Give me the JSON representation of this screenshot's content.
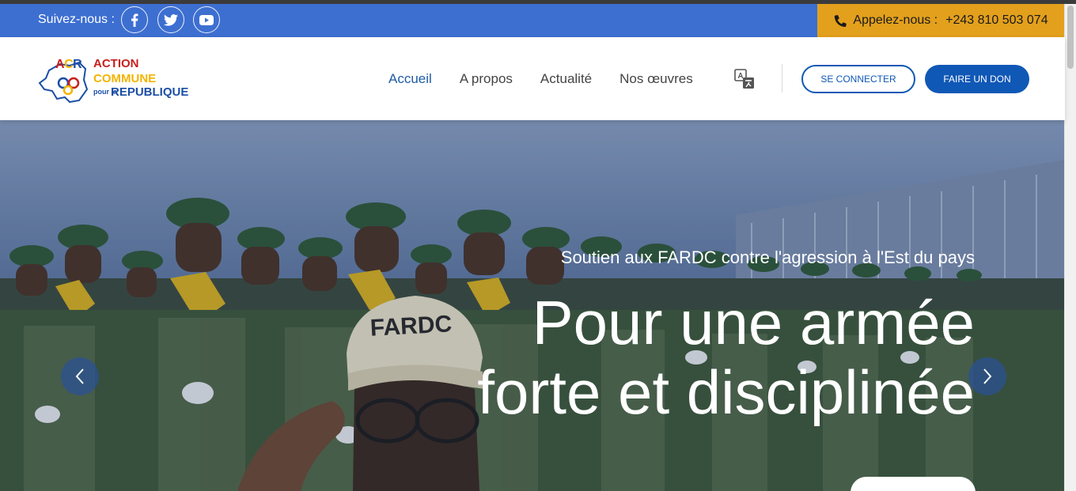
{
  "topbar": {
    "follow_label": "Suivez-nous :",
    "socials": [
      "facebook-icon",
      "twitter-icon",
      "youtube-icon"
    ],
    "call_label": "Appelez-nous :",
    "phone": "+243 810 503 074"
  },
  "logo": {
    "acr_a": "A",
    "acr_c": "C",
    "acr_r": "R",
    "line1": "ACTION",
    "line2": "COMMUNE",
    "line3": "pour la",
    "line4": "REPUBLIQUE"
  },
  "nav": {
    "items": [
      {
        "label": "Accueil",
        "active": true
      },
      {
        "label": "A propos",
        "active": false
      },
      {
        "label": "Actualité",
        "active": false
      },
      {
        "label": "Nos œuvres",
        "active": false
      }
    ],
    "login_label": "SE CONNECTER",
    "donate_label": "FAIRE UN DON"
  },
  "hero": {
    "subtitle": "Soutien aux FARDC contre l'agression à l'Est du pays",
    "headline": "Pour une armée forte et disciplinée",
    "cap_text": "FARDC",
    "prev_icon": "chevron-left-icon",
    "next_icon": "chevron-right-icon"
  },
  "colors": {
    "topbar": "#3d6fd1",
    "call_box": "#e3a01c",
    "primary": "#1058b6",
    "logo_red": "#c6201f",
    "logo_yellow": "#f2b400",
    "logo_blue": "#1b4ea6"
  }
}
